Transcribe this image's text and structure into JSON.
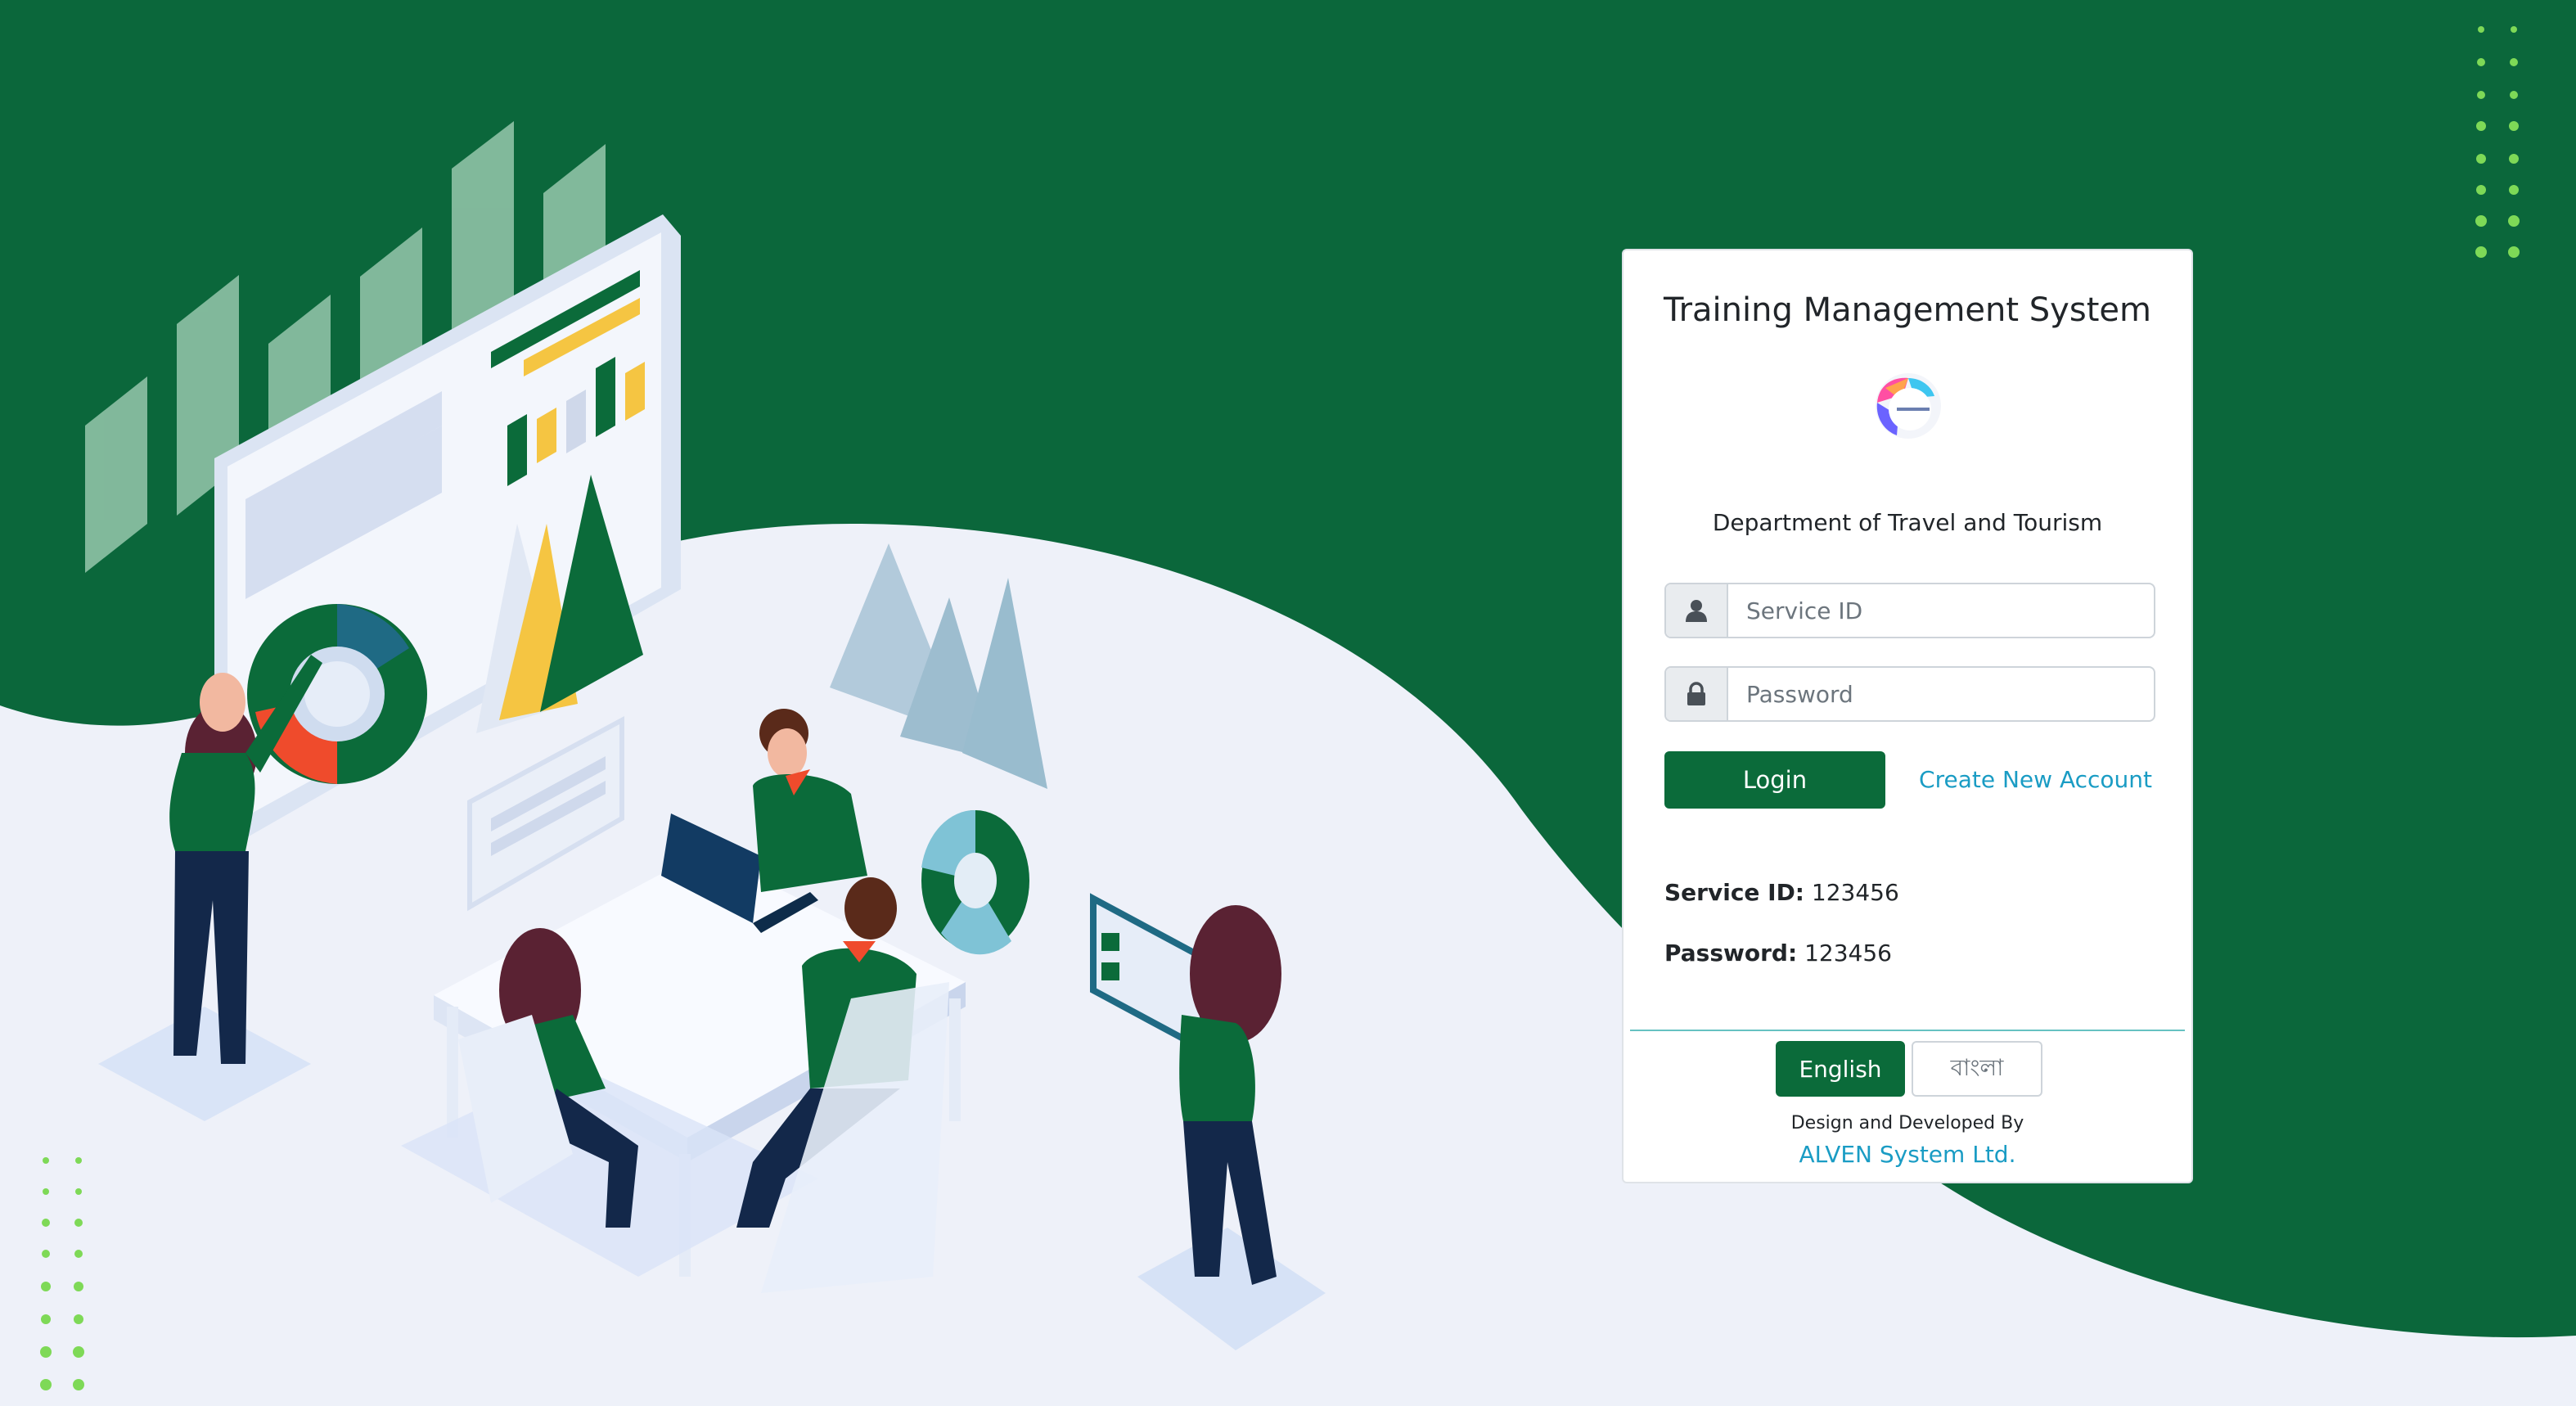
{
  "app": {
    "title": "Training Management System",
    "department": "Department of Travel and Tourism"
  },
  "login_form": {
    "service_id_placeholder": "Service ID",
    "password_placeholder": "Password",
    "login_label": "Login",
    "create_account_label": "Create New Account"
  },
  "demo_credentials": {
    "service_id_label": "Service ID:",
    "service_id_value": "123456",
    "password_label": "Password:",
    "password_value": "123456"
  },
  "language": {
    "english_label": "English",
    "bangla_label": "বাংলা",
    "selected": "English"
  },
  "footer": {
    "designed_by": "Design and Developed By",
    "company": "ALVEN System Ltd."
  },
  "colors": {
    "brand_green": "#0b6b3a",
    "link_blue": "#1a9cc4",
    "background_light": "#eef1f9"
  },
  "icons": [
    "user-icon",
    "lock-icon"
  ]
}
